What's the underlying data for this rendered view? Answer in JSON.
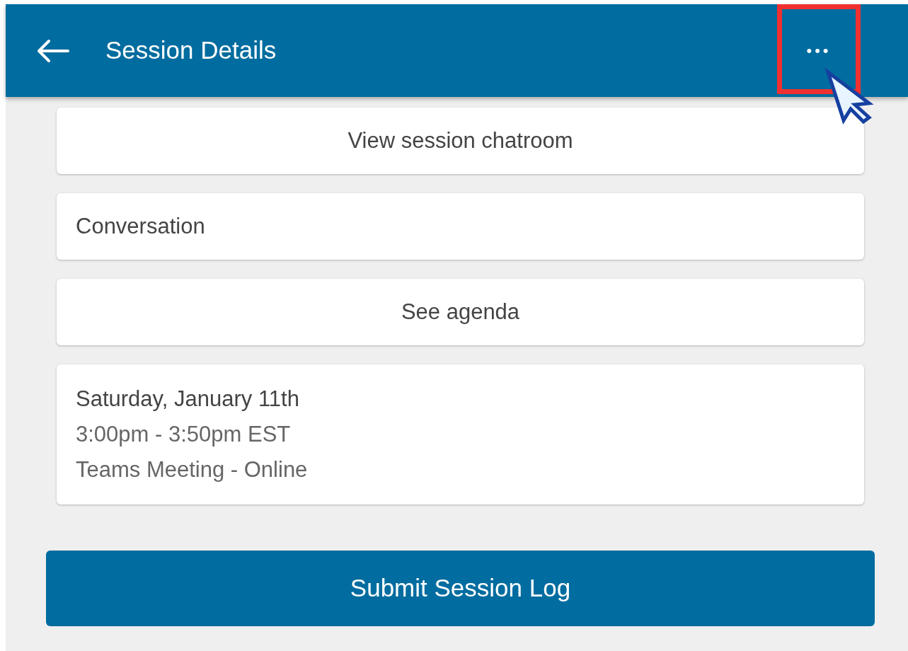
{
  "header": {
    "title": "Session Details",
    "menu_label": "•••",
    "menu_highlighted": true
  },
  "cards": [
    {
      "kind": "link",
      "text": "View session chatroom"
    },
    {
      "kind": "row",
      "text": "Conversation"
    },
    {
      "kind": "link",
      "text": "See agenda"
    },
    {
      "kind": "details",
      "date": "Saturday, January 11th",
      "time": "3:00pm - 3:50pm EST",
      "location": "Teams Meeting - Online"
    }
  ],
  "submit_button": "Submit Session Log"
}
